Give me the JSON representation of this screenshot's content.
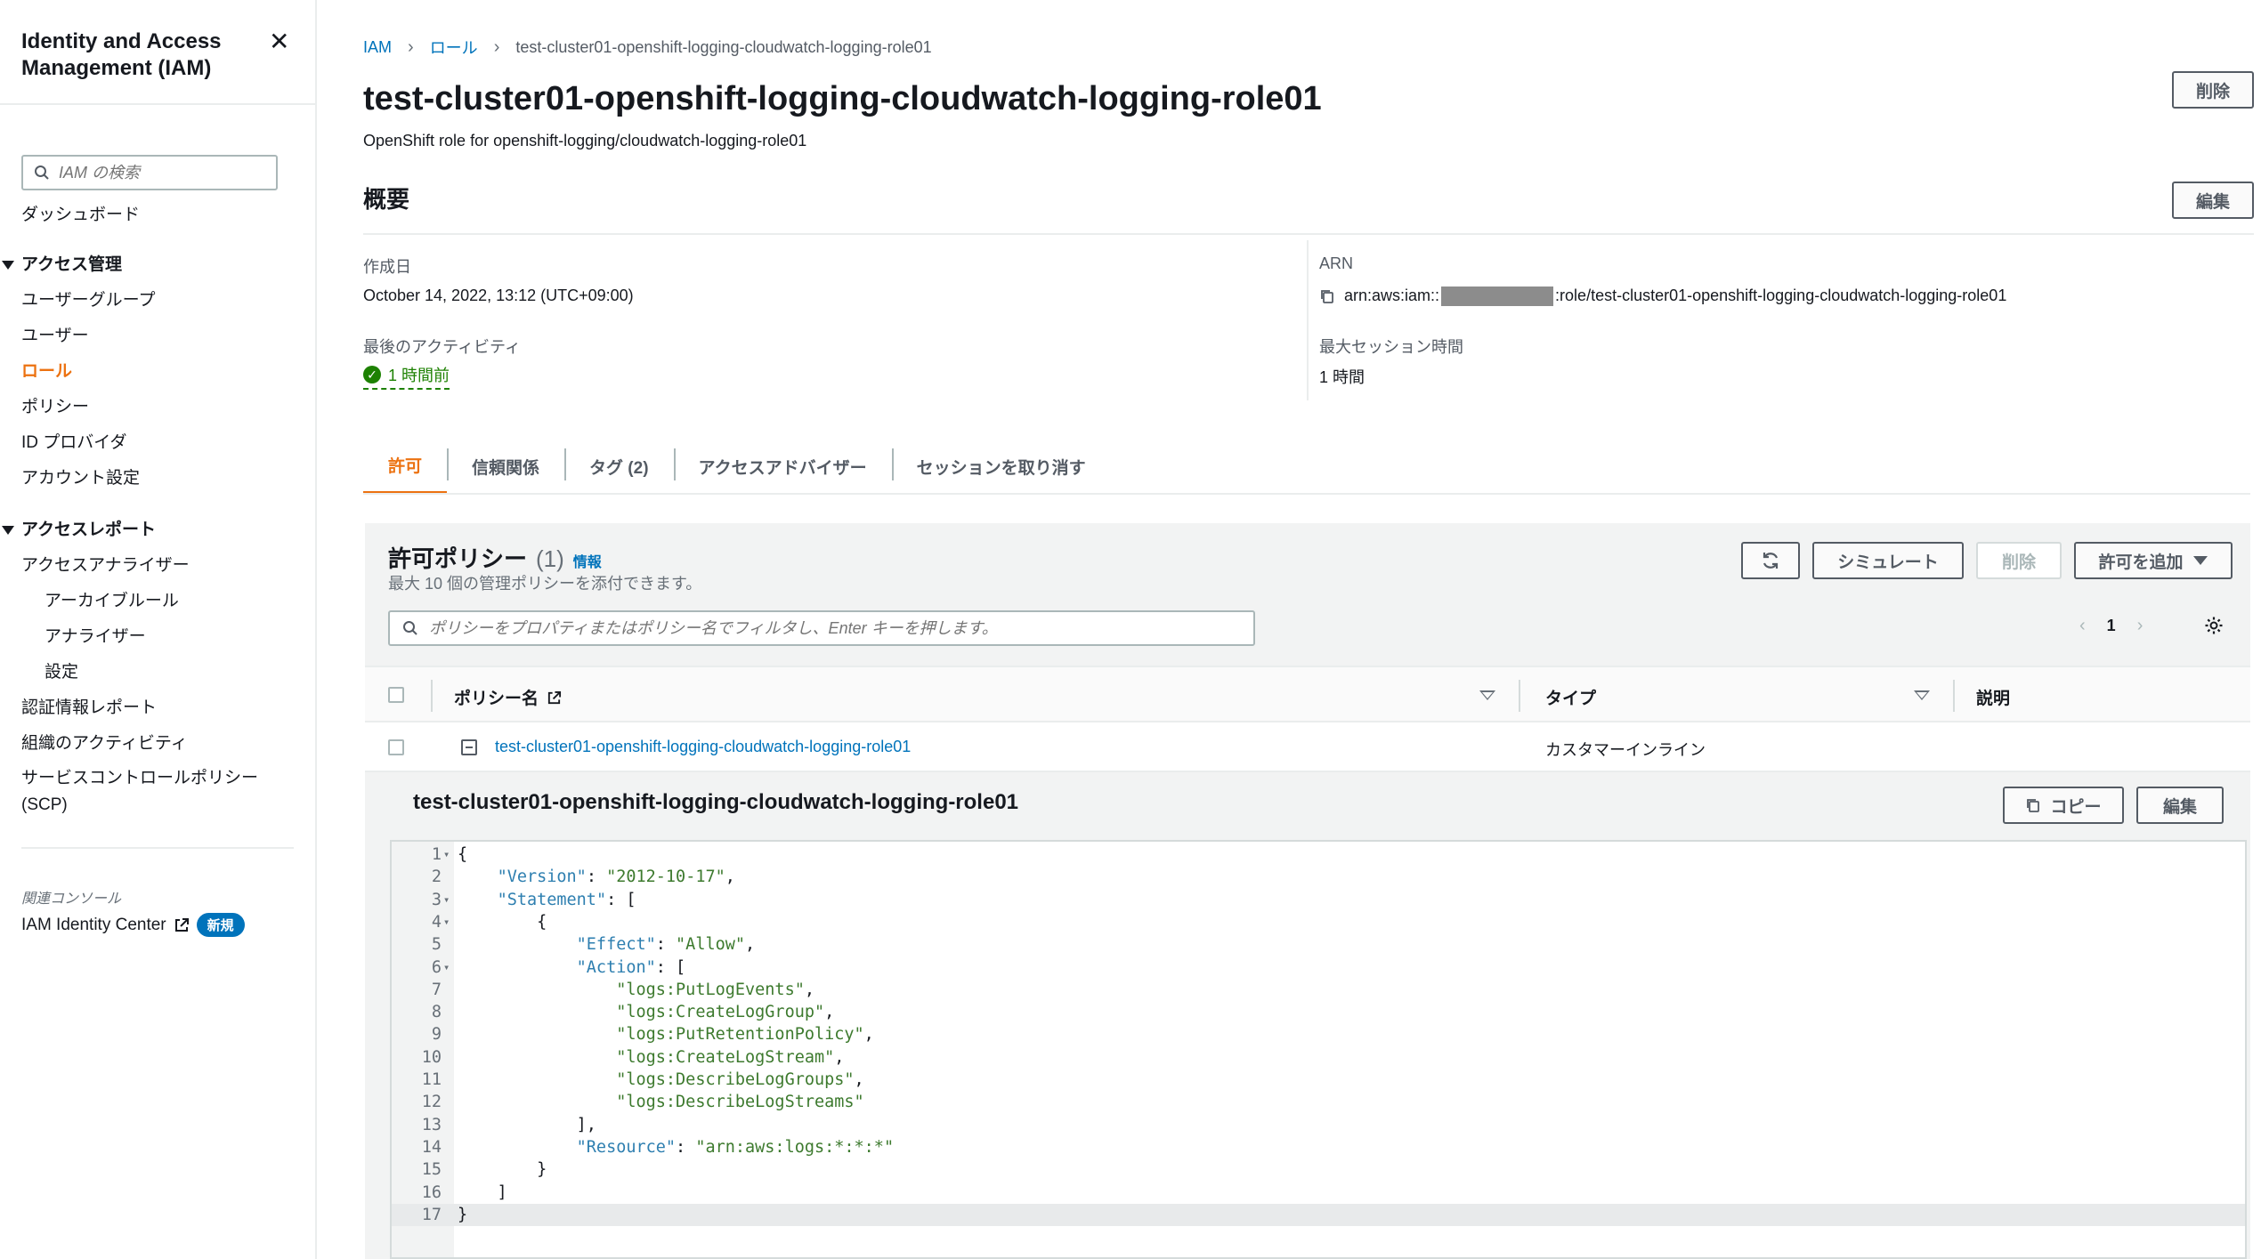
{
  "sidebar": {
    "title": "Identity and Access Management (IAM)",
    "close_icon": "close-icon",
    "search_placeholder": "IAM の検索",
    "dashboard": "ダッシュボード",
    "access_mgmt_section": "アクセス管理",
    "access_mgmt_items": [
      "ユーザーグループ",
      "ユーザー",
      "ロール",
      "ポリシー",
      "ID プロバイダ",
      "アカウント設定"
    ],
    "active_item": "ロール",
    "access_report_section": "アクセスレポート",
    "analyzer": "アクセスアナライザー",
    "analyzer_sub": [
      "アーカイブルール",
      "アナライザー",
      "設定"
    ],
    "report_items": [
      "認証情報レポート",
      "組織のアクティビティ"
    ],
    "scp_line1": "サービスコントロールポリシー",
    "scp_line2": "(SCP)",
    "related_label": "関連コンソール",
    "identity_center": "IAM Identity Center",
    "new_badge": "新規"
  },
  "breadcrumb": {
    "iam": "IAM",
    "roles": "ロール",
    "current": "test-cluster01-openshift-logging-cloudwatch-logging-role01"
  },
  "header": {
    "title": "test-cluster01-openshift-logging-cloudwatch-logging-role01",
    "description": "OpenShift role for openshift-logging/cloudwatch-logging-role01",
    "delete_button": "削除"
  },
  "summary": {
    "title": "概要",
    "edit_button": "編集",
    "created_label": "作成日",
    "created_value": "October 14, 2022, 13:12 (UTC+09:00)",
    "last_activity_label": "最後のアクティビティ",
    "last_activity_value": "1 時間前",
    "arn_label": "ARN",
    "arn_prefix": "arn:aws:iam::",
    "arn_suffix": ":role/test-cluster01-openshift-logging-cloudwatch-logging-role01",
    "max_session_label": "最大セッション時間",
    "max_session_value": "1 時間"
  },
  "tabs": [
    "許可",
    "信頼関係",
    "タグ (2)",
    "アクセスアドバイザー",
    "セッションを取り消す"
  ],
  "active_tab": "許可",
  "permissions": {
    "title": "許可ポリシー",
    "count": "(1)",
    "info": "情報",
    "description": "最大 10 個の管理ポリシーを添付できます。",
    "refresh_icon": "refresh-icon",
    "simulate_button": "シミュレート",
    "remove_button": "削除",
    "add_button": "許可を追加",
    "filter_placeholder": "ポリシーをプロパティまたはポリシー名でフィルタし、Enter キーを押します。",
    "page": "1",
    "columns": [
      "ポリシー名",
      "タイプ",
      "説明"
    ],
    "rows": [
      {
        "name": "test-cluster01-openshift-logging-cloudwatch-logging-role01",
        "type": "カスタマーインライン",
        "description": ""
      }
    ]
  },
  "policy_detail": {
    "title": "test-cluster01-openshift-logging-cloudwatch-logging-role01",
    "copy_button": "コピー",
    "edit_button": "編集",
    "code_lines": [
      "{",
      "    \"Version\": \"2012-10-17\",",
      "    \"Statement\": [",
      "        {",
      "            \"Effect\": \"Allow\",",
      "            \"Action\": [",
      "                \"logs:PutLogEvents\",",
      "                \"logs:CreateLogGroup\",",
      "                \"logs:PutRetentionPolicy\",",
      "                \"logs:CreateLogStream\",",
      "                \"logs:DescribeLogGroups\",",
      "                \"logs:DescribeLogStreams\"",
      "            ],",
      "            \"Resource\": \"arn:aws:logs:*:*:*\"",
      "        }",
      "    ]",
      "}"
    ],
    "foldable_lines": [
      1,
      3,
      4,
      6
    ],
    "highlighted_line": 17
  },
  "colors": {
    "accent": "#ec7211",
    "link": "#0073bb",
    "success": "#1d8102"
  }
}
